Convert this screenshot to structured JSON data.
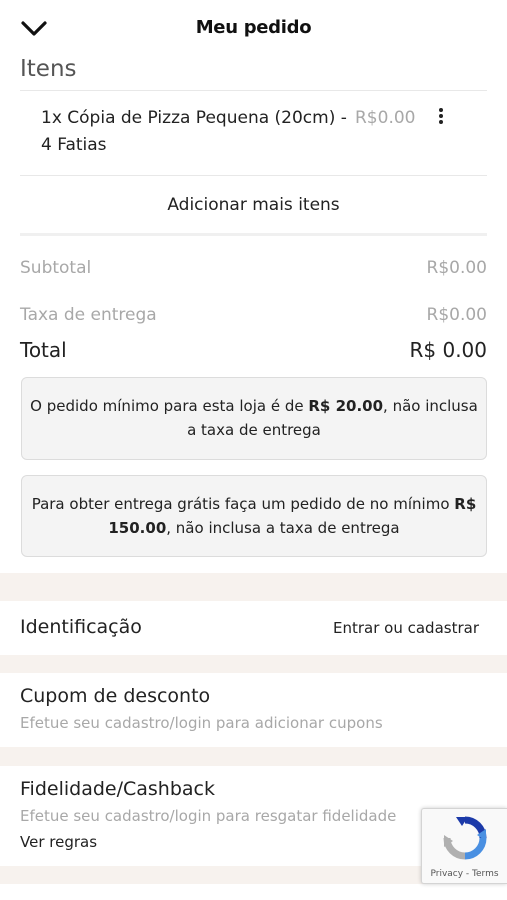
{
  "header": {
    "title": "Meu pedido",
    "back_icon": "chevron-down-icon"
  },
  "items_section": {
    "title": "Itens"
  },
  "cart_items": [
    {
      "name": "1x Cópia de Pizza Pequena (20cm) - 4 Fatias",
      "price": "R$0.00",
      "menu_icon": "more-vertical-icon"
    }
  ],
  "add_more_label": "Adicionar mais itens",
  "summary": {
    "subtotal_label": "Subtotal",
    "subtotal_value": "R$0.00",
    "delivery_label": "Taxa de entrega",
    "delivery_value": "R$0.00",
    "total_label": "Total",
    "total_value": "R$ 0.00"
  },
  "notices": {
    "minimum": {
      "pre": "O pedido mínimo para esta loja é de ",
      "amount": "R$ 20.00",
      "post": ", não inclusa a taxa de entrega"
    },
    "free_delivery": {
      "pre": "Para obter entrega grátis faça um pedido de no mínimo ",
      "amount": "R$ 150.00",
      "post": ", não inclusa a taxa de entrega"
    }
  },
  "identification": {
    "label": "Identificação",
    "action": "Entrar ou cadastrar"
  },
  "coupon": {
    "title": "Cupom de desconto",
    "subtitle": "Efetue seu cadastro/login para adicionar cupons"
  },
  "loyalty": {
    "title": "Fidelidade/Cashback",
    "subtitle": "Efetue seu cadastro/login para resgatar fidelidade",
    "link": "Ver regras"
  },
  "recaptcha": {
    "links": "Privacy - Terms",
    "icon": "recaptcha-icon"
  },
  "colors": {
    "band": "#f7f2ee",
    "muted_text": "#a8a8a8",
    "notice_bg": "#f4f4f4"
  }
}
